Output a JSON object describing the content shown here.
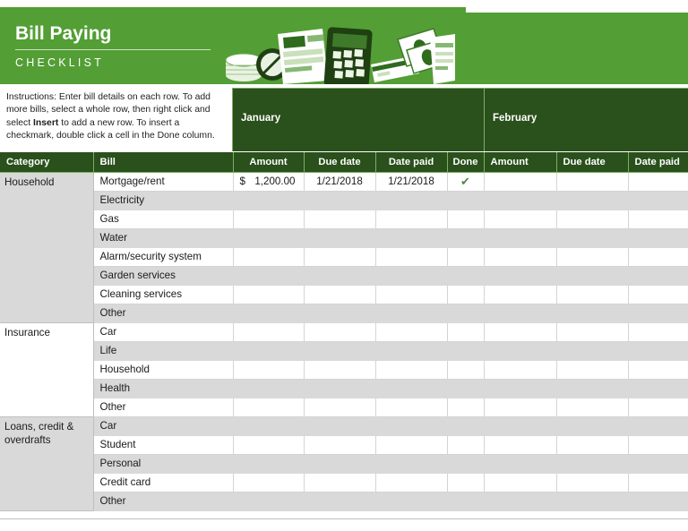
{
  "banner": {
    "title": "Bill Paying",
    "subtitle": "CHECKLIST",
    "bg_color": "#539E35"
  },
  "instructions": {
    "part1": "Instructions: Enter bill details on each row. To add more bills, select a whole row, then right click and select ",
    "bold": "Insert",
    "part2": " to add a new row. To insert a checkmark, double click a cell in the Done column."
  },
  "months": [
    {
      "label": "January"
    },
    {
      "label": "February"
    }
  ],
  "header_color": "#2A501C",
  "columns": {
    "category": "Category",
    "bill": "Bill",
    "amount": "Amount",
    "due_date": "Due date",
    "date_paid": "Date paid",
    "done": "Done"
  },
  "check_glyph": "✔",
  "check_color": "#4E8A4A",
  "rows": [
    {
      "category": "Household",
      "category_rowspan": 8,
      "category_shade": "gray",
      "bill": "Mortgage/rent",
      "jan": {
        "currency": "$",
        "amount": "1,200.00",
        "due_date": "1/21/2018",
        "date_paid": "1/21/2018",
        "done": "✔"
      },
      "feb": {
        "currency": "",
        "amount": "",
        "due_date": "",
        "date_paid": ""
      },
      "shade": "white"
    },
    {
      "bill": "Electricity",
      "jan": {
        "currency": "",
        "amount": "",
        "due_date": "",
        "date_paid": "",
        "done": ""
      },
      "feb": {
        "currency": "",
        "amount": "",
        "due_date": "",
        "date_paid": ""
      },
      "shade": "gray"
    },
    {
      "bill": "Gas",
      "jan": {
        "currency": "",
        "amount": "",
        "due_date": "",
        "date_paid": "",
        "done": ""
      },
      "feb": {
        "currency": "",
        "amount": "",
        "due_date": "",
        "date_paid": ""
      },
      "shade": "white"
    },
    {
      "bill": "Water",
      "jan": {
        "currency": "",
        "amount": "",
        "due_date": "",
        "date_paid": "",
        "done": ""
      },
      "feb": {
        "currency": "",
        "amount": "",
        "due_date": "",
        "date_paid": ""
      },
      "shade": "gray"
    },
    {
      "bill": "Alarm/security system",
      "jan": {
        "currency": "",
        "amount": "",
        "due_date": "",
        "date_paid": "",
        "done": ""
      },
      "feb": {
        "currency": "",
        "amount": "",
        "due_date": "",
        "date_paid": ""
      },
      "shade": "white"
    },
    {
      "bill": "Garden services",
      "jan": {
        "currency": "",
        "amount": "",
        "due_date": "",
        "date_paid": "",
        "done": ""
      },
      "feb": {
        "currency": "",
        "amount": "",
        "due_date": "",
        "date_paid": ""
      },
      "shade": "gray"
    },
    {
      "bill": "Cleaning services",
      "jan": {
        "currency": "",
        "amount": "",
        "due_date": "",
        "date_paid": "",
        "done": ""
      },
      "feb": {
        "currency": "",
        "amount": "",
        "due_date": "",
        "date_paid": ""
      },
      "shade": "white"
    },
    {
      "bill": "Other",
      "jan": {
        "currency": "",
        "amount": "",
        "due_date": "",
        "date_paid": "",
        "done": ""
      },
      "feb": {
        "currency": "",
        "amount": "",
        "due_date": "",
        "date_paid": ""
      },
      "shade": "gray"
    },
    {
      "category": "Insurance",
      "category_rowspan": 5,
      "category_shade": "white",
      "bill": "Car",
      "jan": {
        "currency": "",
        "amount": "",
        "due_date": "",
        "date_paid": "",
        "done": ""
      },
      "feb": {
        "currency": "",
        "amount": "",
        "due_date": "",
        "date_paid": ""
      },
      "shade": "white"
    },
    {
      "bill": "Life",
      "jan": {
        "currency": "",
        "amount": "",
        "due_date": "",
        "date_paid": "",
        "done": ""
      },
      "feb": {
        "currency": "",
        "amount": "",
        "due_date": "",
        "date_paid": ""
      },
      "shade": "gray"
    },
    {
      "bill": "Household",
      "jan": {
        "currency": "",
        "amount": "",
        "due_date": "",
        "date_paid": "",
        "done": ""
      },
      "feb": {
        "currency": "",
        "amount": "",
        "due_date": "",
        "date_paid": ""
      },
      "shade": "white"
    },
    {
      "bill": "Health",
      "jan": {
        "currency": "",
        "amount": "",
        "due_date": "",
        "date_paid": "",
        "done": ""
      },
      "feb": {
        "currency": "",
        "amount": "",
        "due_date": "",
        "date_paid": ""
      },
      "shade": "gray"
    },
    {
      "bill": "Other",
      "jan": {
        "currency": "",
        "amount": "",
        "due_date": "",
        "date_paid": "",
        "done": ""
      },
      "feb": {
        "currency": "",
        "amount": "",
        "due_date": "",
        "date_paid": ""
      },
      "shade": "white"
    },
    {
      "category": "Loans, credit & overdrafts",
      "category_rowspan": 5,
      "category_shade": "gray",
      "bill": "Car",
      "jan": {
        "currency": "",
        "amount": "",
        "due_date": "",
        "date_paid": "",
        "done": ""
      },
      "feb": {
        "currency": "",
        "amount": "",
        "due_date": "",
        "date_paid": ""
      },
      "shade": "gray"
    },
    {
      "bill": "Student",
      "jan": {
        "currency": "",
        "amount": "",
        "due_date": "",
        "date_paid": "",
        "done": ""
      },
      "feb": {
        "currency": "",
        "amount": "",
        "due_date": "",
        "date_paid": ""
      },
      "shade": "white"
    },
    {
      "bill": "Personal",
      "jan": {
        "currency": "",
        "amount": "",
        "due_date": "",
        "date_paid": "",
        "done": ""
      },
      "feb": {
        "currency": "",
        "amount": "",
        "due_date": "",
        "date_paid": ""
      },
      "shade": "gray"
    },
    {
      "bill": "Credit card",
      "jan": {
        "currency": "",
        "amount": "",
        "due_date": "",
        "date_paid": "",
        "done": ""
      },
      "feb": {
        "currency": "",
        "amount": "",
        "due_date": "",
        "date_paid": ""
      },
      "shade": "white"
    },
    {
      "bill": "Other",
      "jan": {
        "currency": "",
        "amount": "",
        "due_date": "",
        "date_paid": "",
        "done": ""
      },
      "feb": {
        "currency": "",
        "amount": "",
        "due_date": "",
        "date_paid": ""
      },
      "shade": "gray"
    }
  ],
  "illustration": {
    "items": [
      "coins-stack",
      "coin-icon",
      "invoice-document",
      "calculator",
      "credit-card",
      "banknotes",
      "receipt"
    ]
  }
}
